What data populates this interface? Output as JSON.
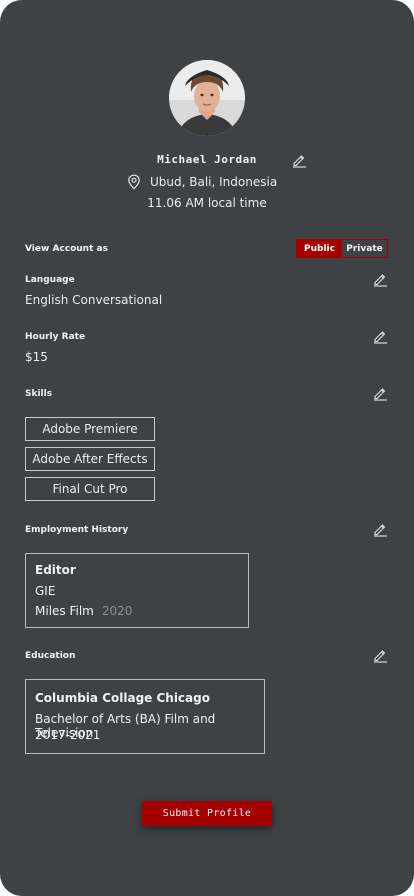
{
  "profile": {
    "name": "Michael Jordan",
    "location": "Ubud, Bali, Indonesia",
    "local_time": "11.06 AM local time"
  },
  "view_account": {
    "label": "View Account as",
    "options": [
      "Public",
      "Private"
    ],
    "selected": "Public"
  },
  "language": {
    "label": "Language",
    "value": "English Conversational"
  },
  "hourly_rate": {
    "label": "Hourly Rate",
    "value": "$15"
  },
  "skills": {
    "label": "Skills",
    "items": [
      "Adobe Premiere",
      "Adobe After Effects",
      "Final Cut Pro"
    ]
  },
  "employment": {
    "label": "Employment History",
    "title": "Editor",
    "company": "GIE",
    "client": "Miles Film",
    "year": "2020"
  },
  "education": {
    "label": "Education",
    "school": "Columbia Collage Chicago",
    "degree": "Bachelor of Arts (BA) Film and Television",
    "years": "2017-2021"
  },
  "submit_label": "Submit Profile",
  "colors": {
    "background": "#3e4245",
    "accent": "#a40000",
    "text": "#f1f1f1",
    "muted": "#8e8f90"
  },
  "icons": [
    "avatar-photo",
    "pencil-edit-icon",
    "location-pin-icon"
  ]
}
